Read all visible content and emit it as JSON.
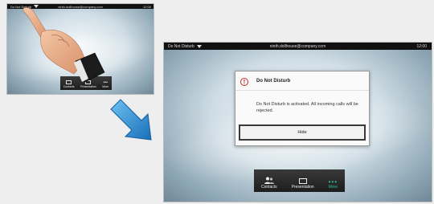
{
  "small_screen": {
    "status_dnd": "Do Not Disturb",
    "status_address": "ninth.dollhouse@company.com",
    "status_time": "12:00",
    "toolbar": [
      {
        "label": "Contacts",
        "icon": "contacts-icon"
      },
      {
        "label": "Presentation",
        "icon": "presentation-icon"
      },
      {
        "label": "More",
        "icon": "more-icon"
      }
    ]
  },
  "large_screen": {
    "status_dnd": "Do Not Disturb",
    "status_address": "ninth.dollhouse@company.com",
    "status_time": "12:00",
    "dialog": {
      "title": "Do Not Disturb",
      "message": "Do Not Disturb is activated. All incoming calls will be rejected.",
      "hide_label": "Hide"
    },
    "toolbar": [
      {
        "label": "Contacts",
        "icon": "contacts-icon"
      },
      {
        "label": "Presentation",
        "icon": "presentation-icon"
      },
      {
        "label": "More",
        "icon": "more-icon"
      }
    ]
  },
  "colors": {
    "accent_more": "#2fbf9f",
    "warning": "#c62828",
    "arrow": "#2a8fd6"
  }
}
